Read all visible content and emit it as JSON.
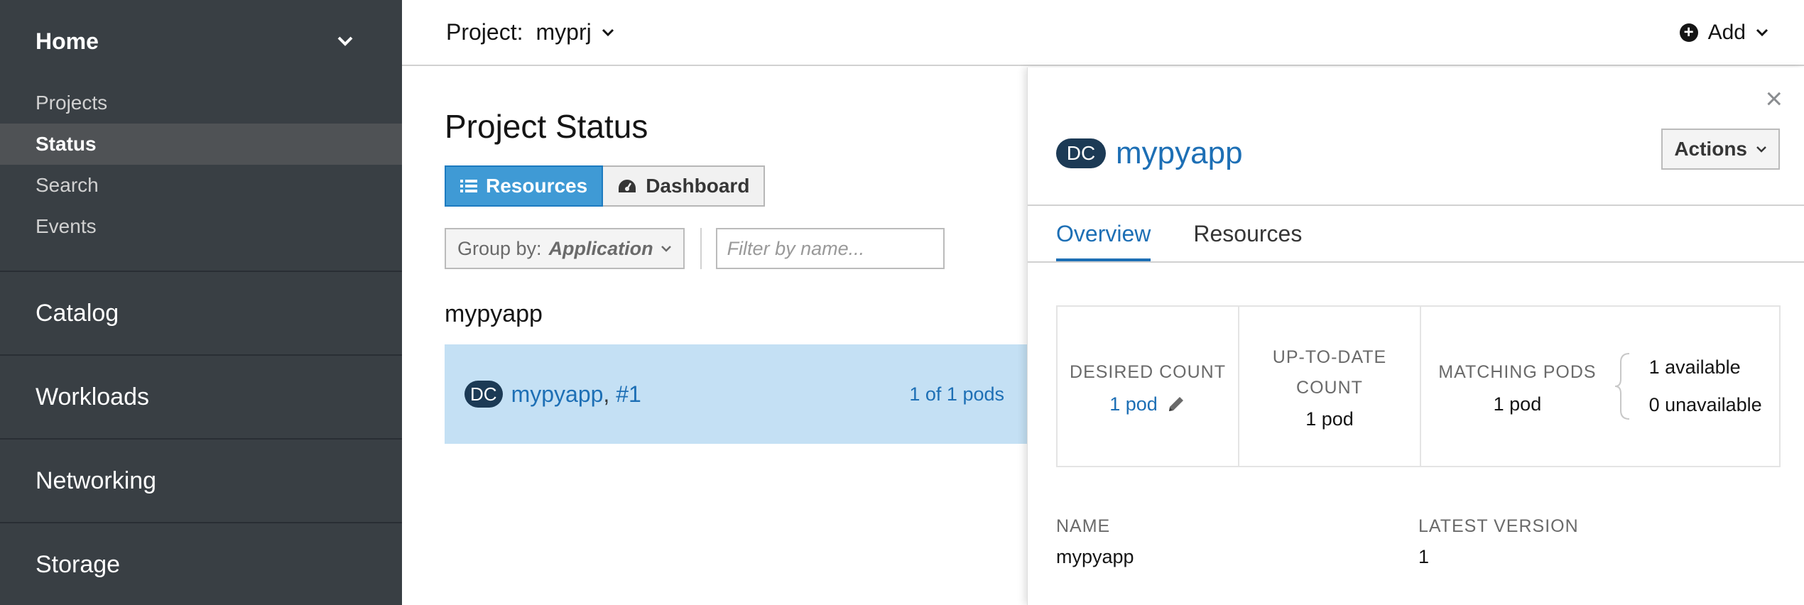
{
  "sidebar": {
    "home_label": "Home",
    "sub_items": [
      {
        "label": "Projects",
        "active": false
      },
      {
        "label": "Status",
        "active": true
      },
      {
        "label": "Search",
        "active": false
      },
      {
        "label": "Events",
        "active": false
      }
    ],
    "groups": [
      "Catalog",
      "Workloads",
      "Networking",
      "Storage"
    ]
  },
  "topbar": {
    "project_label": "Project:",
    "project_name": "myprj",
    "add_label": "Add"
  },
  "main": {
    "title": "Project Status",
    "view_toggle": {
      "resources": "Resources",
      "dashboard": "Dashboard"
    },
    "group_by_label": "Group by:",
    "group_by_value": "Application",
    "filter_placeholder": "Filter by name...",
    "app_heading": "mypyapp",
    "row": {
      "badge": "DC",
      "name": "mypyapp",
      "separator": ",",
      "version": "#1",
      "pods": "1 of 1 pods"
    }
  },
  "panel": {
    "badge": "DC",
    "name": "mypyapp",
    "actions_label": "Actions",
    "tabs": [
      {
        "label": "Overview",
        "active": true
      },
      {
        "label": "Resources",
        "active": false
      }
    ],
    "desired_count_label": "DESIRED COUNT",
    "desired_count_value": "1 pod",
    "uptodate_label_1": "UP-TO-DATE",
    "uptodate_label_2": "COUNT",
    "uptodate_value": "1 pod",
    "matching_label": "MATCHING PODS",
    "matching_value": "1 pod",
    "available": "1 available",
    "unavailable": "0 unavailable",
    "name_label": "NAME",
    "name_value": "mypyapp",
    "version_label": "LATEST VERSION",
    "version_value": "1"
  },
  "colors": {
    "sidebar_bg": "#393f44",
    "accent": "#1d6fb5",
    "row_highlight": "#c4e0f4",
    "toggle_active": "#3f9ad5"
  }
}
